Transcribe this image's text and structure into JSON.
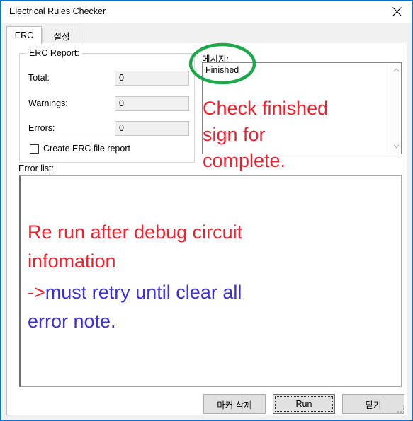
{
  "window": {
    "title": "Electrical Rules Checker",
    "close_icon": "close-icon"
  },
  "tabs": [
    {
      "label": "ERC",
      "active": true
    },
    {
      "label": "설정",
      "active": false
    }
  ],
  "erc_report": {
    "group_title": "ERC Report:",
    "rows": [
      {
        "label": "Total:",
        "value": "0"
      },
      {
        "label": "Warnings:",
        "value": "0"
      },
      {
        "label": "Errors:",
        "value": "0"
      }
    ],
    "checkbox": {
      "label": "Create ERC file report",
      "checked": false
    }
  },
  "message_panel": {
    "label": "메시지:",
    "text": "Finished",
    "scroll_up_icon": "chevron-up-icon",
    "scroll_down_icon": "chevron-down-icon"
  },
  "error_list": {
    "label": "Error list:",
    "items": []
  },
  "buttons": {
    "delete_marker": "마커 삭제",
    "run": "Run",
    "close": "닫기"
  },
  "annotations": {
    "colors": {
      "red": "#f0212f",
      "blue": "#3b31d8",
      "green": "#1ea84c"
    },
    "message_note": "Check finished\nsign for\ncomplete.",
    "rerun_note": "Re run after debug circuit\ninfomation",
    "retry_arrow": "->",
    "retry_note": "must retry until clear all\nerror note.",
    "ellipse": "green-ellipse-highlight"
  }
}
